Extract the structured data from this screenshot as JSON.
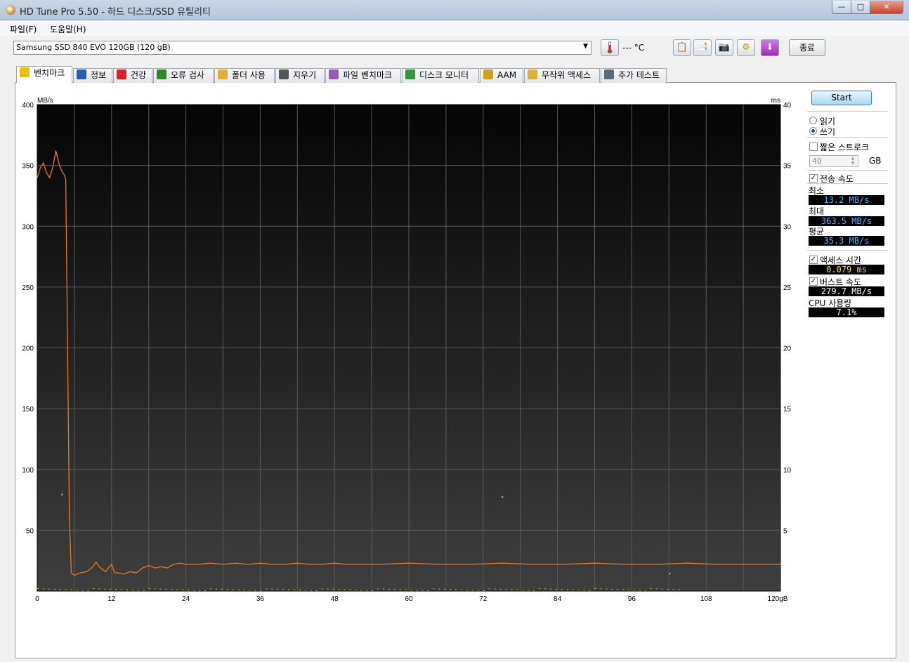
{
  "window": {
    "title": "HD Tune Pro 5.50 - 하드 디스크/SSD 유틸리티"
  },
  "menu": [
    "파일(F)",
    "도움말(H)"
  ],
  "toolbar": {
    "drive": "Samsung SSD 840 EVO 120GB (120 gB)",
    "temperature": "--- °C",
    "exit_label": "종료"
  },
  "tabs": [
    {
      "label": "벤치마크",
      "icon": "lightbulb-icon",
      "color": "#e8c200"
    },
    {
      "label": "정보",
      "icon": "info-icon",
      "color": "#1f5fbf"
    },
    {
      "label": "건강",
      "icon": "health-cross-icon",
      "color": "#d22"
    },
    {
      "label": "오류 검사",
      "icon": "magnifier-icon",
      "color": "#2a8a2a"
    },
    {
      "label": "폴더 사용",
      "icon": "folder-icon",
      "color": "#e0b030"
    },
    {
      "label": "지우기",
      "icon": "trash-icon",
      "color": "#555"
    },
    {
      "label": "파일 벤치마크",
      "icon": "file-bench-icon",
      "color": "#9b59b6"
    },
    {
      "label": "디스크 모니터",
      "icon": "monitor-chart-icon",
      "color": "#2a9a3a"
    },
    {
      "label": "AAM",
      "icon": "speaker-icon",
      "color": "#d4a017"
    },
    {
      "label": "무작위 액세스",
      "icon": "random-access-icon",
      "color": "#e0b030"
    },
    {
      "label": "추가 테스트",
      "icon": "calculator-icon",
      "color": "#5a6a7a"
    }
  ],
  "side": {
    "start_label": "Start",
    "read_label": "읽기",
    "write_label": "쓰기",
    "short_stroke_label": "짧은 스트로크",
    "short_stroke_value": "40",
    "gb_unit": "GB",
    "transfer_label": "전송 속도",
    "min_label": "최소",
    "min_value": "13.2 MB/s",
    "max_label": "최대",
    "max_value": "363.5 MB/s",
    "avg_label": "평균",
    "avg_value": "35.3 MB/s",
    "access_label": "액세스 시간",
    "access_value": "0.079 ms",
    "burst_label": "버스트 속도",
    "burst_value": "279.7 MB/s",
    "cpu_label": "CPU 사용량",
    "cpu_value": "7.1%"
  },
  "chart_data": {
    "type": "line",
    "ylabel": "MB/s",
    "y2label": "ms",
    "ylim": [
      0,
      400
    ],
    "y2lim": [
      0,
      40
    ],
    "xlim": [
      0,
      120
    ],
    "x_unit": "gB",
    "x_ticks": [
      "0",
      "12",
      "24",
      "36",
      "48",
      "60",
      "72",
      "84",
      "96",
      "108",
      "120gB"
    ],
    "y_ticks": [
      "50",
      "100",
      "150",
      "200",
      "250",
      "300",
      "350",
      "400"
    ],
    "y2_ticks": [
      "5",
      "10",
      "15",
      "20",
      "25",
      "30",
      "35",
      "40"
    ],
    "series": [
      {
        "x": [
          0,
          0.5,
          1,
          1.5,
          2,
          2.5,
          3,
          3.2,
          3.6,
          4,
          4.4,
          4.6,
          4.9,
          5.2,
          5.5,
          6,
          7,
          8,
          9,
          9.5,
          10,
          11,
          12,
          12.5,
          13,
          14,
          15,
          16,
          17,
          18,
          19,
          20,
          21,
          22,
          23,
          24,
          26,
          28,
          30,
          32,
          34,
          36,
          38,
          40,
          42,
          44,
          46,
          48,
          50,
          55,
          60,
          65,
          70,
          75,
          80,
          85,
          90,
          95,
          100,
          105,
          110,
          115,
          120
        ],
        "y": [
          340,
          348,
          352,
          344,
          340,
          348,
          362,
          358,
          350,
          345,
          342,
          338,
          200,
          60,
          15,
          13,
          15,
          16,
          20,
          24,
          20,
          16,
          22,
          15,
          15,
          14,
          16,
          15,
          19,
          21,
          19,
          20,
          19,
          22,
          23,
          22,
          22,
          23,
          22,
          23,
          22,
          23,
          22,
          22,
          23,
          22,
          22,
          23,
          22,
          22,
          23,
          22,
          22,
          23,
          22,
          22,
          23,
          22,
          22,
          23,
          22,
          22,
          22
        ]
      }
    ],
    "access_scatter": [
      {
        "x": 3.9,
        "y": 8
      },
      {
        "x": 75,
        "y": 7.8
      },
      {
        "x": 102,
        "y": 1.5
      }
    ],
    "grid": true
  }
}
